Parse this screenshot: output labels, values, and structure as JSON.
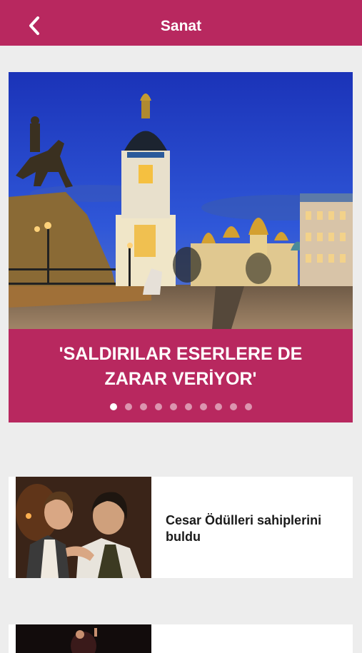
{
  "header": {
    "title": "Sanat",
    "back_icon": "chevron-left-icon"
  },
  "colors": {
    "brand": "#b8285f",
    "background": "#ededed"
  },
  "hero": {
    "title": "'SALDIRILAR ESERLERE DE ZARAR VERİYOR'",
    "page_count": 10,
    "active_page": 1
  },
  "news": [
    {
      "title": "Cesar Ödülleri sahiplerini buldu"
    },
    {
      "title": ""
    }
  ]
}
